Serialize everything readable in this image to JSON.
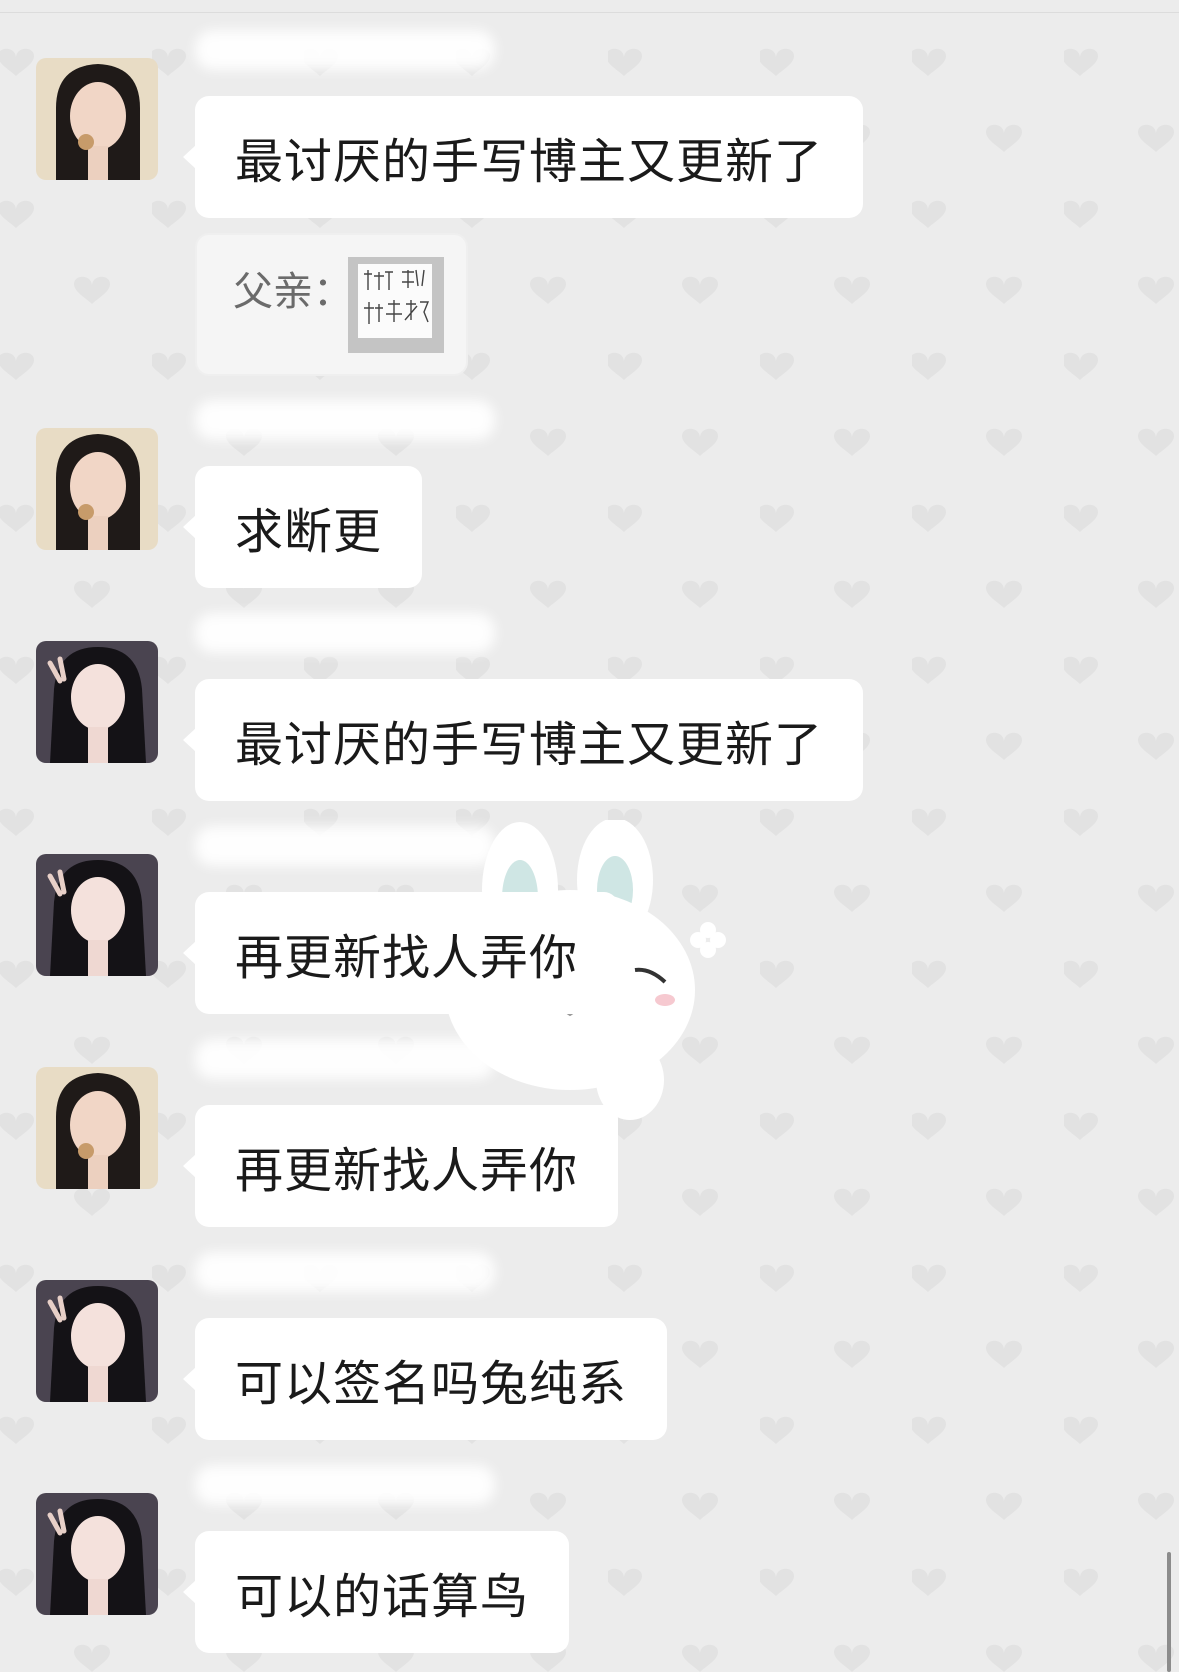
{
  "chat": {
    "messages": [
      {
        "sender": "friend-a",
        "text": "最讨厌的手写博主又更新了"
      },
      {
        "sender": "friend-a",
        "text": "求断更"
      },
      {
        "sender": "friend-b",
        "text": "最讨厌的手写博主又更新了"
      },
      {
        "sender": "friend-b",
        "text": "再更新找人弄你"
      },
      {
        "sender": "friend-a",
        "text": "再更新找人弄你"
      },
      {
        "sender": "friend-b",
        "text": "可以签名吗兔纯系"
      },
      {
        "sender": "friend-b",
        "text": "可以的话算鸟"
      }
    ],
    "quote": {
      "label": "父亲：",
      "thumbnail_text": "雅慕以 你牛大了"
    }
  },
  "colors": {
    "background": "#ececec",
    "bubble": "#ffffff",
    "quote_background": "#f5f5f5",
    "heart": "#e2e2e2",
    "text": "#1a1a1a"
  },
  "icons": {
    "background_pattern": "heart-icon",
    "sticker": "bunny-sticker",
    "avatar_a": "avatar",
    "avatar_b": "avatar"
  }
}
